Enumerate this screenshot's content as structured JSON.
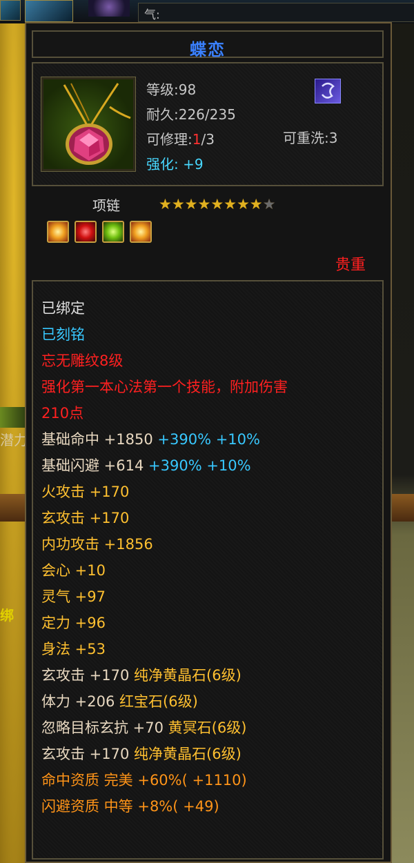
{
  "hud": {
    "qi_label": "气:",
    "side_text_1": "潜力",
    "side_text_2": "绑"
  },
  "item": {
    "name": "蝶恋",
    "stats": {
      "level": "等级:98",
      "durability": "耐久:226/235",
      "repair_prefix": "可修理:",
      "repair_current": "1",
      "repair_suffix": "/3",
      "rewash": "可重洗:3",
      "enhance_label": "强化:",
      "enhance_value": "+9"
    },
    "type": "项链",
    "stars": {
      "filled": 8,
      "total": 9
    },
    "gems": [
      "gold-gem",
      "red-gem",
      "green-gem",
      "gold-gem"
    ],
    "rarity": "贵重",
    "description": [
      {
        "text": "已绑定",
        "color": "white"
      },
      {
        "text": "已刻铭",
        "color": "cyan"
      },
      {
        "text": "忘无雕纹8级",
        "color": "red"
      },
      {
        "text": "强化第一本心法第一个技能，附加伤害",
        "color": "red"
      },
      {
        "text": "210点",
        "color": "red"
      },
      {
        "parts": [
          {
            "text": "基础命中 +1850 ",
            "color": "tan"
          },
          {
            "text": "+390% +10%",
            "color": "cyan"
          }
        ]
      },
      {
        "parts": [
          {
            "text": "基础闪避 +614 ",
            "color": "tan"
          },
          {
            "text": "+390% +10%",
            "color": "cyan"
          }
        ]
      },
      {
        "text": "火攻击 +170",
        "color": "yellow"
      },
      {
        "text": "玄攻击 +170",
        "color": "yellow"
      },
      {
        "text": "内功攻击 +1856",
        "color": "yellow"
      },
      {
        "text": "会心 +10",
        "color": "yellow"
      },
      {
        "text": "灵气 +97",
        "color": "yellow"
      },
      {
        "text": "定力 +96",
        "color": "yellow"
      },
      {
        "text": "身法 +53",
        "color": "yellow"
      },
      {
        "parts": [
          {
            "text": "玄攻击 +170 ",
            "color": "tan"
          },
          {
            "text": "纯净黄晶石(6级)",
            "color": "yellow"
          }
        ]
      },
      {
        "parts": [
          {
            "text": "体力 +206 ",
            "color": "tan"
          },
          {
            "text": "红宝石(6级)",
            "color": "yellow"
          }
        ]
      },
      {
        "parts": [
          {
            "text": "忽略目标玄抗 +70 ",
            "color": "tan"
          },
          {
            "text": "黄冥石(6级)",
            "color": "yellow"
          }
        ]
      },
      {
        "parts": [
          {
            "text": "玄攻击 +170 ",
            "color": "tan"
          },
          {
            "text": "纯净黄晶石(6级)",
            "color": "yellow"
          }
        ]
      },
      {
        "text": "命中资质  完美 +60%( +1110)",
        "color": "orange"
      },
      {
        "text": "闪避资质  中等 +8%( +49)",
        "color": "orange"
      }
    ]
  }
}
